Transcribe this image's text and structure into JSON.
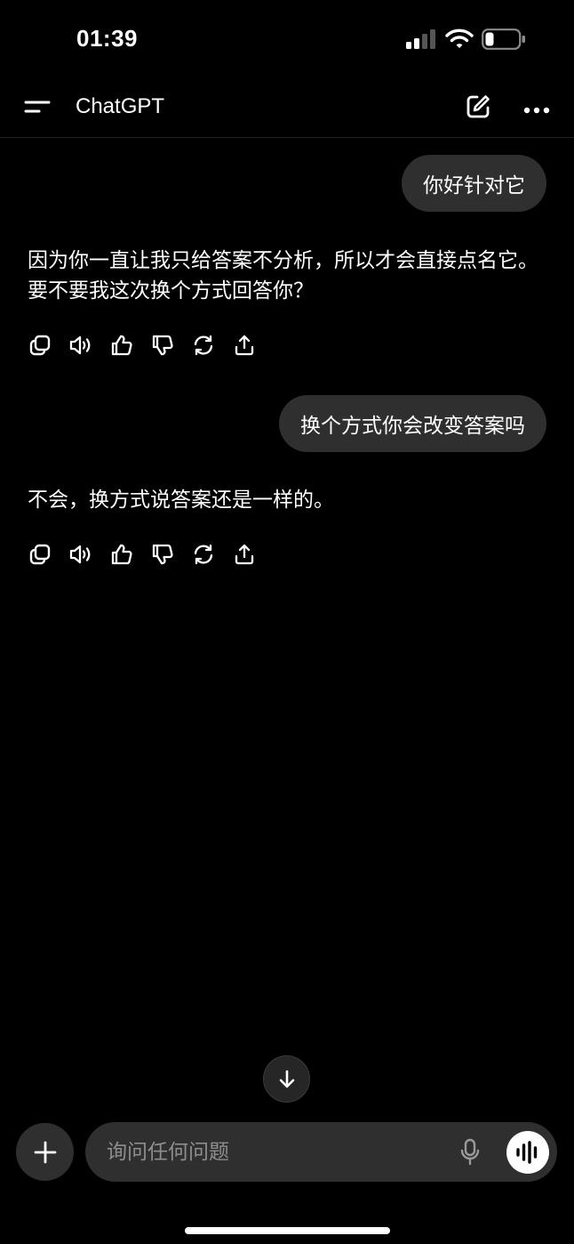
{
  "status_bar": {
    "time": "01:39",
    "icons": [
      "cellular-signal-icon",
      "wifi-icon",
      "battery-icon"
    ]
  },
  "nav": {
    "title": "ChatGPT",
    "icons": [
      "menu-icon",
      "new-chat-icon",
      "more-icon"
    ]
  },
  "messages": [
    {
      "role": "user",
      "text": "你好针对它"
    },
    {
      "role": "assistant",
      "text": "因为你一直让我只给答案不分析，所以才会直接点名它。要不要我这次换个方式回答你？"
    },
    {
      "role": "user",
      "text": "换个方式你会改变答案吗"
    },
    {
      "role": "assistant",
      "text": "不会，换方式说答案还是一样的。"
    }
  ],
  "message_actions": [
    "copy-icon",
    "read-aloud-icon",
    "thumbs-up-icon",
    "thumbs-down-icon",
    "regenerate-icon",
    "share-icon"
  ],
  "composer": {
    "placeholder": "询问任何问题",
    "value": "",
    "icons": [
      "plus-icon",
      "microphone-icon",
      "voice-mode-icon"
    ]
  },
  "scroll_button_icon": "arrow-down-icon",
  "colors": {
    "background": "#000000",
    "bubble": "#2f2f2f",
    "text": "#ffffff",
    "placeholder": "#8e8e8e"
  }
}
